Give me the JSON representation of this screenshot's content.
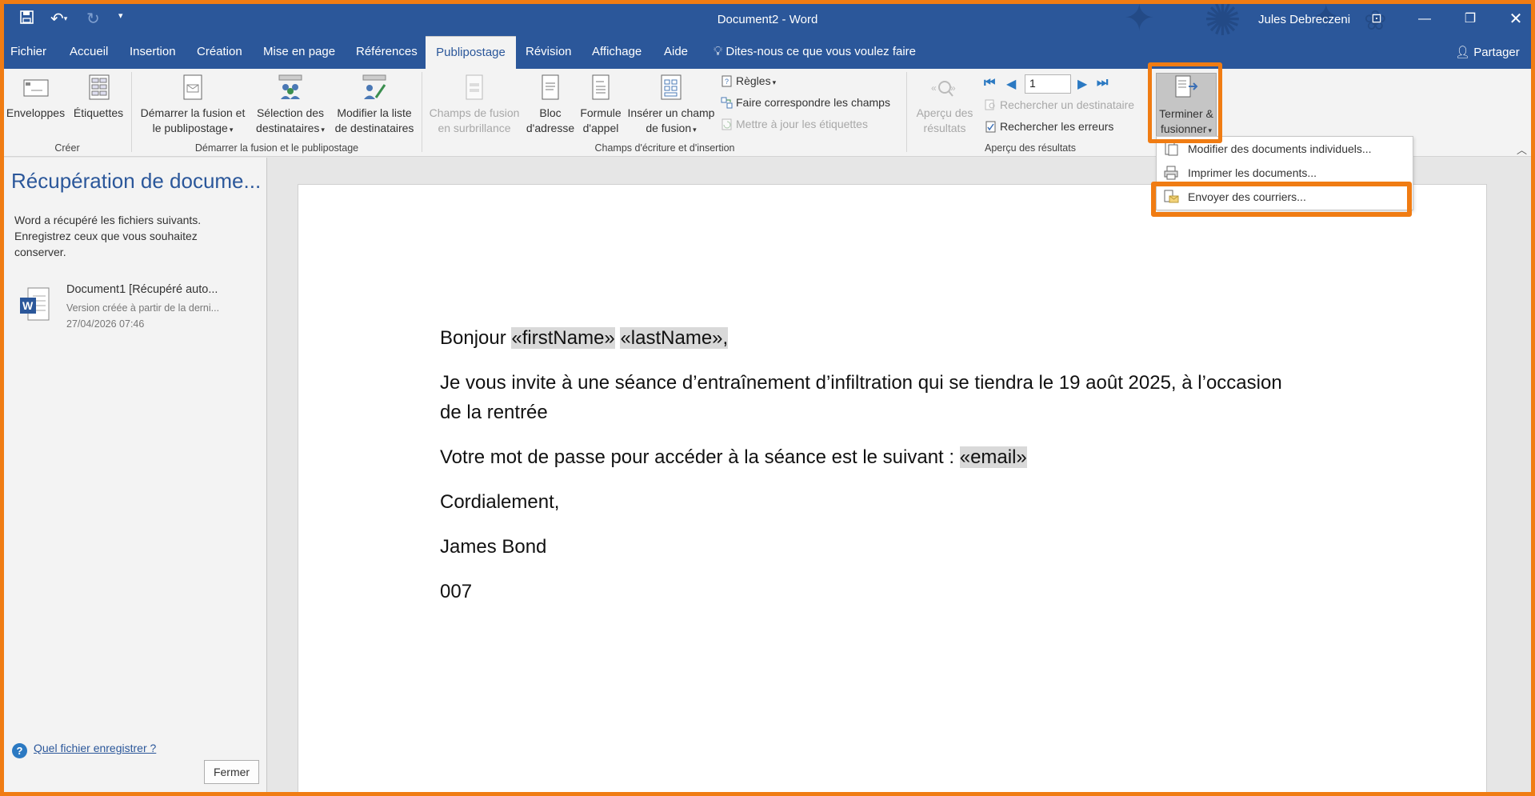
{
  "titlebar": {
    "title": "Document2  -  Word",
    "user": "Jules Debreczeni"
  },
  "tabs": [
    {
      "label": "Fichier"
    },
    {
      "label": "Accueil"
    },
    {
      "label": "Insertion"
    },
    {
      "label": "Création"
    },
    {
      "label": "Mise en page"
    },
    {
      "label": "Références"
    },
    {
      "label": "Publipostage",
      "active": true
    },
    {
      "label": "Révision"
    },
    {
      "label": "Affichage"
    },
    {
      "label": "Aide"
    }
  ],
  "tell_me": "Dites-nous ce que vous voulez faire",
  "share": "Partager",
  "ribbon": {
    "creer": {
      "label": "Créer",
      "enveloppes": "Enveloppes",
      "etiquettes": "Étiquettes"
    },
    "demarrer": {
      "label": "Démarrer la fusion et le publipostage",
      "demarrer_l1": "Démarrer la fusion et",
      "demarrer_l2": "le publipostage",
      "selection_l1": "Sélection des",
      "selection_l2": "destinataires",
      "modifier_l1": "Modifier la liste",
      "modifier_l2": "de destinataires"
    },
    "champs": {
      "label": "Champs d'écriture et d'insertion",
      "surbrillance_l1": "Champs de fusion",
      "surbrillance_l2": "en surbrillance",
      "bloc_l1": "Bloc",
      "bloc_l2": "d'adresse",
      "formule_l1": "Formule",
      "formule_l2": "d'appel",
      "inserer_l1": "Insérer un champ",
      "inserer_l2": "de fusion",
      "regles": "Règles",
      "faire_correspondre": "Faire correspondre les champs",
      "mettre_a_jour": "Mettre à jour les étiquettes"
    },
    "apercu": {
      "label": "Aperçu des résultats",
      "apercu_l1": "Aperçu des",
      "apercu_l2": "résultats",
      "record_value": "1",
      "rechercher_destinataire": "Rechercher un destinataire",
      "rechercher_erreurs": "Rechercher les erreurs"
    },
    "terminer": {
      "terminer_l1": "Terminer &",
      "terminer_l2": "fusionner"
    }
  },
  "dropdown": {
    "items": [
      {
        "label": "Modifier des documents individuels..."
      },
      {
        "label": "Imprimer les documents..."
      },
      {
        "label": "Envoyer des courriers..."
      }
    ]
  },
  "recovery": {
    "title": "Récupération de docume...",
    "description": "Word a récupéré les fichiers suivants. Enregistrez ceux que vous souhaitez conserver.",
    "file": {
      "name": "Document1  [Récupéré auto...",
      "version": "Version créée à partir de la derni...",
      "date": "27/04/2026 07:46"
    },
    "help_link": "Quel fichier enregistrer ?",
    "close": "Fermer"
  },
  "document": {
    "greeting": "Bonjour",
    "field_firstname": "«firstName»",
    "field_lastname": "«lastName»,",
    "para1_l1": "Je vous invite à une séance d’entraînement d’infiltration qui se tiendra le 19 août 2025, à l’occasion",
    "para1_l2": "de la rentrée",
    "para2": "Votre mot de passe pour accéder à la séance est le suivant :",
    "field_email": "«email»",
    "closing": "Cordialement,",
    "signature": "James Bond",
    "code": "007"
  },
  "colors": {
    "word_blue": "#2b579a",
    "highlight_orange": "#f07c13",
    "field_gray": "#d9d9d9"
  }
}
